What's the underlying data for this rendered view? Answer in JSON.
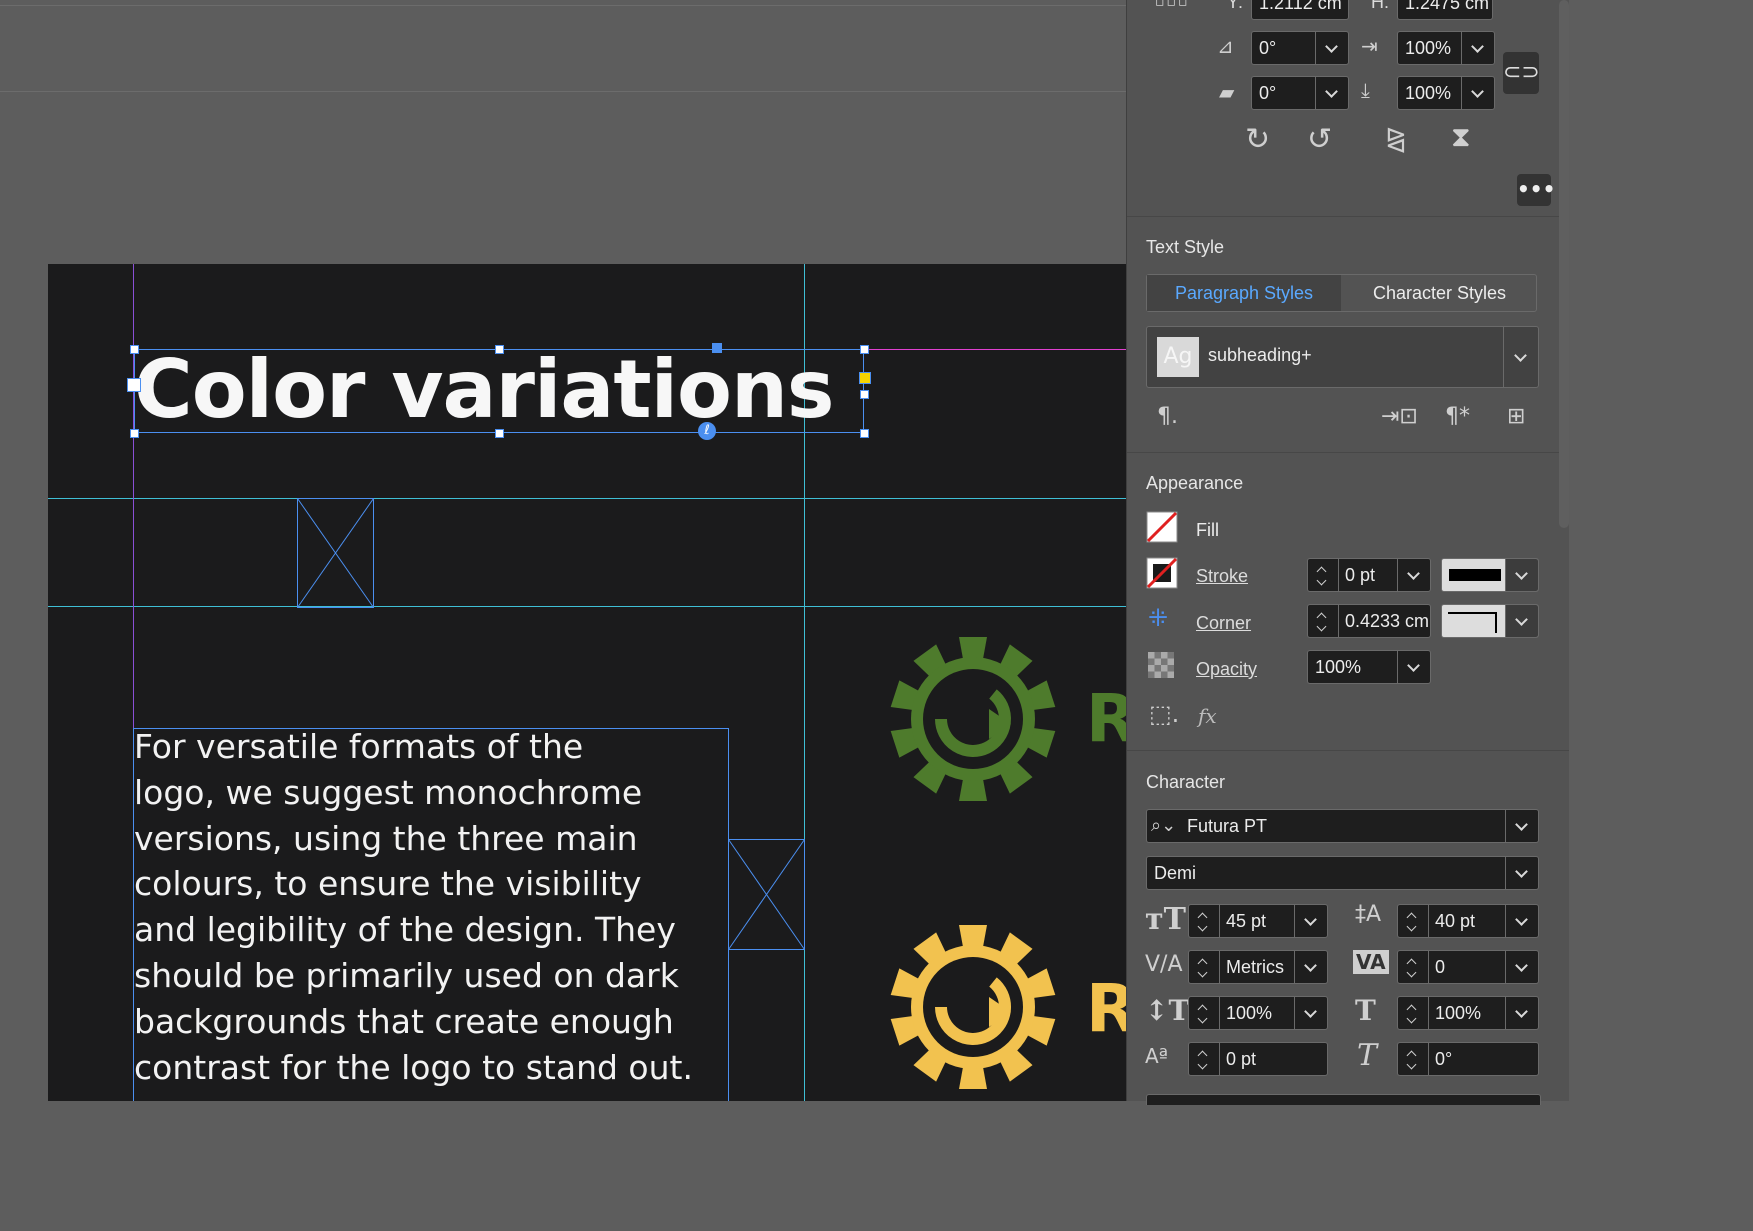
{
  "document": {
    "title": "Color variations",
    "body_lines": [
      "For versatile formats of the",
      "logo, we suggest monochrome",
      "versions, using the three main",
      "colours, to ensure the visibility",
      "and legibility of the design. They",
      "should be primarily used on dark",
      "backgrounds that create enough",
      "contrast for the logo to stand out."
    ],
    "logo_green_letter": "R",
    "logo_yellow_letter": "R",
    "colors": {
      "page_bg": "#1b1b1c",
      "logo_green": "#4e7b2c",
      "logo_yellow": "#f2c24f",
      "guide": "#3fbfd5"
    }
  },
  "transform": {
    "y_label": "Y:",
    "y_value": "1.2112 cm",
    "h_label": "H:",
    "h_value": "1.2475 cm",
    "rotate_value": "0°",
    "scale_x_value": "100%",
    "shear_value": "0°",
    "scale_y_value": "100%"
  },
  "text_style": {
    "title": "Text Style",
    "tab_paragraph": "Paragraph Styles",
    "tab_character": "Character Styles",
    "style_preview": "Ag",
    "style_name": "subheading+"
  },
  "appearance": {
    "title": "Appearance",
    "fill_label": "Fill",
    "stroke_label": "Stroke",
    "stroke_value": "0 pt",
    "corner_label": "Corner",
    "corner_value": "0.4233 cm",
    "opacity_label": "Opacity",
    "opacity_value": "100%",
    "fx_label": "fx"
  },
  "character": {
    "title": "Character",
    "font_family": "Futura PT",
    "font_style": "Demi",
    "font_size": "45 pt",
    "leading": "40 pt",
    "kerning": "Metrics",
    "tracking": "0",
    "vertical_scale": "100%",
    "horizontal_scale": "100%",
    "baseline_shift": "0 pt",
    "skew": "0°"
  }
}
